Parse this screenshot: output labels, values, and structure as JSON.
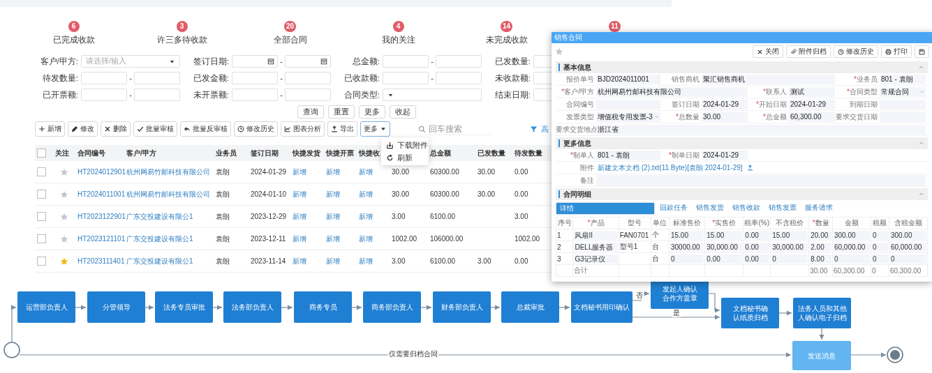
{
  "stats": [
    {
      "count": "6",
      "label": "已完成收款"
    },
    {
      "count": "3",
      "label": "许三多待收款"
    },
    {
      "count": "20",
      "label": "全部合同"
    },
    {
      "count": "4",
      "label": "我的关注"
    },
    {
      "count": "14",
      "label": "未完成收款"
    },
    {
      "count": "11"
    }
  ],
  "range_separator": "-",
  "filters": [
    {
      "label": "客户/甲方:",
      "kind": "select",
      "placeholder": "请选择/输入"
    },
    {
      "label": "签订日期:",
      "kind": "date_range"
    },
    {
      "label": "总金额:",
      "kind": "range"
    },
    {
      "label": "已发数量:",
      "kind": "single"
    },
    {
      "label": "待发数量:",
      "kind": "range"
    },
    {
      "label": "已发金额:",
      "kind": "range"
    },
    {
      "label": "已收款额:",
      "kind": "range"
    },
    {
      "label": "未收款额:",
      "kind": "single"
    },
    {
      "label": "已开票额:",
      "kind": "range"
    },
    {
      "label": "未开票额:",
      "kind": "range"
    },
    {
      "label": "合同类型:",
      "kind": "select"
    },
    {
      "label": "结束日期:",
      "kind": "single"
    }
  ],
  "filter_buttons": [
    "查询",
    "重置",
    "更多",
    "收起"
  ],
  "toolbar": [
    "新增",
    "修改",
    "删除",
    "批量审核",
    "批量反审核",
    "修改历史",
    "图表分析",
    "导出"
  ],
  "more_menu": {
    "label": "更多",
    "expanded": true,
    "items": [
      "下载附件",
      "刷新"
    ]
  },
  "search": {
    "placeholder": "回车搜索"
  },
  "advanced": {
    "label": "高"
  },
  "table": {
    "all_checked": false,
    "follow_header": "关注",
    "columns": [
      {
        "label": "合同编号",
        "kind": "link"
      },
      {
        "label": "客户/甲方",
        "kind": "link"
      },
      {
        "label": "业务员"
      },
      {
        "label": "签订日期"
      },
      {
        "label": "快捷发货",
        "kind": "link"
      },
      {
        "label": "快捷开票",
        "kind": "link"
      },
      {
        "label": "快捷收",
        "kind": "link"
      },
      {
        "kind": "text"
      },
      {
        "label": "总金额"
      },
      {
        "label": "已发数量"
      },
      {
        "label": "待发数量"
      }
    ],
    "rows": [
      {
        "checked": false,
        "starred": false,
        "no": "HT2024012901",
        "customer": "杭州网易竹邮科技有限公司",
        "salesperson": "袁朗",
        "sign_date": "2024-01-29",
        "quick_ship": "新增",
        "quick_invoice": "新增",
        "quick_receipt": "新增",
        "quantity": "30.00",
        "total": "60300.00",
        "shipped": "30.00",
        "pending": "0.00"
      },
      {
        "checked": false,
        "starred": false,
        "no": "HT2024011001",
        "customer": "杭州网易竹邮科技有限公司",
        "salesperson": "袁朗",
        "sign_date": "2024-01-10",
        "quick_ship": "新增",
        "quick_invoice": "新增",
        "quick_receipt": "新增",
        "quantity": "30.00",
        "total": "60300.00",
        "shipped": "30.00",
        "pending": "0.00"
      },
      {
        "checked": false,
        "starred": false,
        "no": "HT2023122901",
        "customer": "广东交投建设有限公1",
        "salesperson": "袁朗",
        "sign_date": "2023-12-29",
        "quick_ship": "新增",
        "quick_invoice": "新增",
        "quick_receipt": "新增",
        "quantity": "3.00",
        "total": "6100.00",
        "pending": "3.00"
      },
      {
        "checked": false,
        "starred": false,
        "no": "HT2023121101",
        "customer": "广东交投建设有限公1",
        "salesperson": "袁朗",
        "sign_date": "2023-12-11",
        "quick_ship": "新增",
        "quick_invoice": "新增",
        "quick_receipt": "新增",
        "quantity": "1002.00",
        "total": "106000.00",
        "pending": "1002.00"
      },
      {
        "checked": false,
        "starred": true,
        "no": "HT2023111401",
        "customer": "广东交投建设有限公1",
        "salesperson": "袁朗",
        "sign_date": "2023-11-14",
        "quick_ship": "新增",
        "quick_invoice": "新增",
        "quick_receipt": "新增",
        "quantity": "3.00",
        "total": "6100.00",
        "shipped": "3.00",
        "pending": "0.00"
      }
    ]
  },
  "dialog": {
    "title": "销售合同",
    "starred": false,
    "actions": [
      "关闭",
      "附件归档",
      "修改历史",
      "打印"
    ],
    "sections": [
      {
        "title": "基本信息",
        "expanded": true,
        "rows": [
          {
            "fields": [
              {
                "label": "报价单号",
                "value": "BJD2024011001"
              },
              {
                "label": "销售商机",
                "value": "聚汇销售商机",
                "kind": "wide"
              },
              {
                "mark": "*",
                "label": "业务员",
                "value": "801 - 袁朗"
              }
            ]
          },
          {
            "fields": [
              {
                "mark": "*",
                "label": "客户/甲方",
                "value": "杭州网易竹邮科技有限公司",
                "kind": "wide"
              },
              {
                "mark": "*",
                "label": "联系人",
                "value": "测试"
              },
              {
                "mark": "*",
                "label": "合同类型",
                "value": "常规合同",
                "kind": "select"
              }
            ]
          },
          {
            "fields": [
              {
                "label": "合同编号"
              },
              {
                "label": "签订日期",
                "value": "2024-01-29"
              },
              {
                "mark": "*",
                "label": "开始日期",
                "value": "2024-01-29"
              },
              {
                "label": "到期日期"
              }
            ]
          },
          {
            "fields": [
              {
                "label": "发票类型",
                "value": "增值税专用发票-3",
                "kind": "select"
              },
              {
                "mark": "*",
                "label": "总数量",
                "value": "30.00"
              },
              {
                "mark": "*",
                "label": "总金额",
                "value": "60,300.00"
              },
              {
                "label": "要求交货日期"
              }
            ]
          },
          {
            "fields": [
              {
                "label": "要求交货地点",
                "value": "浙江省",
                "kind": "full"
              }
            ]
          }
        ]
      },
      {
        "title": "更多信息",
        "expanded": true,
        "rows": [
          {
            "fields": [
              {
                "mark": "*",
                "label": "制单人",
                "value": "801 - 袁朗"
              },
              {
                "mark": "*",
                "label": "制单日期",
                "value": "2024-01-29"
              }
            ]
          },
          {
            "fields": [
              {
                "label": "附件",
                "value": "新建文本文档 (2).txt(11 Byte)[袁朗 2024-01-29]",
                "kind": "file"
              }
            ]
          },
          {
            "fields": [
              {
                "label": "备注",
                "kind": "textarea"
              }
            ]
          }
        ]
      },
      {
        "title": "合同明细",
        "expanded": true
      }
    ],
    "tabs": [
      {
        "label": "详情",
        "selected": true
      },
      {
        "label": "回款任务",
        "selected": false
      },
      {
        "label": "销售发货",
        "selected": false
      },
      {
        "label": "销售收款",
        "selected": false
      },
      {
        "label": "销售发票",
        "selected": false
      },
      {
        "label": "服务请求",
        "selected": false
      }
    ],
    "columns": [
      {
        "label": "序号"
      },
      {
        "mark": "*",
        "label": "产品",
        "kind": "input"
      },
      {
        "label": "型号"
      },
      {
        "label": "单位"
      },
      {
        "label": "标准售价",
        "kind": "input"
      },
      {
        "mark": "*",
        "label": "实售价",
        "kind": "input"
      },
      {
        "label": "税率(%)",
        "kind": "input"
      },
      {
        "label": "不含税价",
        "kind": "input"
      },
      {
        "mark": "*",
        "label": "数量",
        "kind": "input"
      },
      {
        "label": "金额",
        "kind": "input"
      },
      {
        "label": "税额",
        "kind": "input"
      },
      {
        "label": "含税金额",
        "kind": "input"
      }
    ],
    "rows": [
      {
        "seq": "1",
        "product": "风扇II",
        "model": "FAN0701",
        "unit": "个",
        "std_price": "15.00",
        "price": "15.00",
        "tax_rate": "0.00",
        "net_price": "15.00",
        "qty": "20.00",
        "amount": "300.00",
        "tax": "0",
        "gross": "300.00"
      },
      {
        "seq": "2",
        "product": "DELL服务器",
        "model": "型号1",
        "unit": "台",
        "std_price": "30000.00",
        "price": "30,000.00",
        "tax_rate": "0.00",
        "net_price": "30,000.00",
        "qty": "2.00",
        "amount": "60,000.00",
        "tax": "0",
        "gross": "60,000.00"
      },
      {
        "seq": "3",
        "product": "G3记录仪",
        "unit": "台",
        "std_price": "0",
        "price": "0.00",
        "tax_rate": "0.00",
        "net_price": "0",
        "qty": "8.00",
        "amount": "0",
        "tax": "0",
        "gross": "0"
      }
    ],
    "total": {
      "product": "合计",
      "qty": "30.00",
      "amount": "60,300.00",
      "tax": "0",
      "gross": "60,300.00"
    }
  },
  "flow": {
    "nodes": [
      {
        "label": "运营部负责人",
        "kind": "task"
      },
      {
        "label": "分管领导",
        "kind": "task"
      },
      {
        "label": "法务专员审批",
        "kind": "task"
      },
      {
        "label": "法务部负责人",
        "kind": "task"
      },
      {
        "label": "商务专员",
        "kind": "task"
      },
      {
        "label": "商务部负责人",
        "kind": "task"
      },
      {
        "label": "财务部负责人",
        "kind": "task"
      },
      {
        "label": "总裁审批",
        "kind": "task"
      },
      {
        "label": "文档秘书用印确认",
        "kind": "task"
      },
      {
        "label": "发起人确认合作方盖章",
        "kind": "task"
      },
      {
        "label": "文档秘书确认纸质归档",
        "kind": "task"
      },
      {
        "label": "法务人员和其他人确认电子归档",
        "kind": "task"
      },
      {
        "label": "发送消息",
        "kind": "notify"
      }
    ],
    "edge_labels": [
      "否",
      "是",
      "仅需要归档合同"
    ]
  }
}
